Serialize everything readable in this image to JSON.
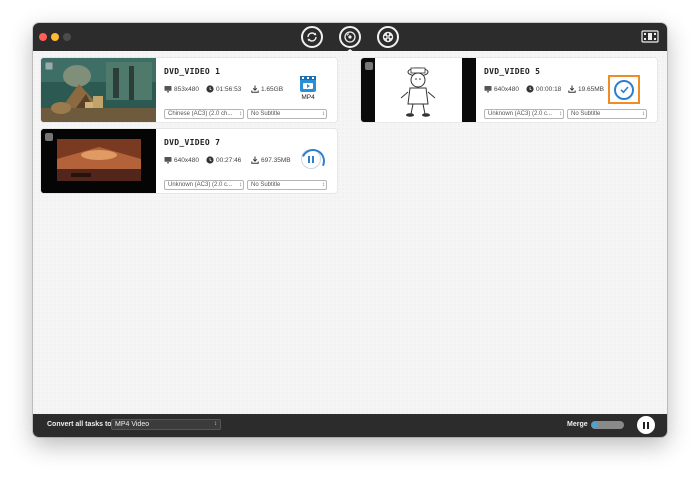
{
  "toolbar": {
    "modes": [
      {
        "name": "converter",
        "icon": "convert-icon"
      },
      {
        "name": "dvd-ripper",
        "icon": "disc-icon"
      },
      {
        "name": "media-tools",
        "icon": "film-reel-icon"
      }
    ],
    "toolbox_icon": "film-toolbox-icon"
  },
  "tasks": [
    {
      "title": "DVD_VIDEO 1",
      "resolution": "853x480",
      "duration": "01:56:53",
      "size": "1.65GB",
      "audio_track": "Chinese (AC3) (2.0 ch...",
      "subtitle": "No Subtitle",
      "format_label": "MP4",
      "status": "format"
    },
    {
      "title": "DVD_VIDEO 5",
      "resolution": "640x480",
      "duration": "00:00:18",
      "size": "19.65MB",
      "audio_track": "Unknown (AC3) (2.0 c...",
      "subtitle": "No Subtitle",
      "status": "done"
    },
    {
      "title": "DVD_VIDEO 7",
      "resolution": "640x480",
      "duration": "00:27:46",
      "size": "697.35MB",
      "audio_track": "Unknown (AC3) (2.0 c...",
      "subtitle": "No Subtitle",
      "status": "converting"
    }
  ],
  "bottom": {
    "convert_all_label": "Convert all tasks to",
    "convert_all_value": "MP4 Video",
    "merge_label": "Merge",
    "merge_on": false
  },
  "colors": {
    "accent_blue": "#2d7fd1",
    "highlight_orange": "#ef8c25",
    "bar_dark": "#2c2c2c"
  }
}
